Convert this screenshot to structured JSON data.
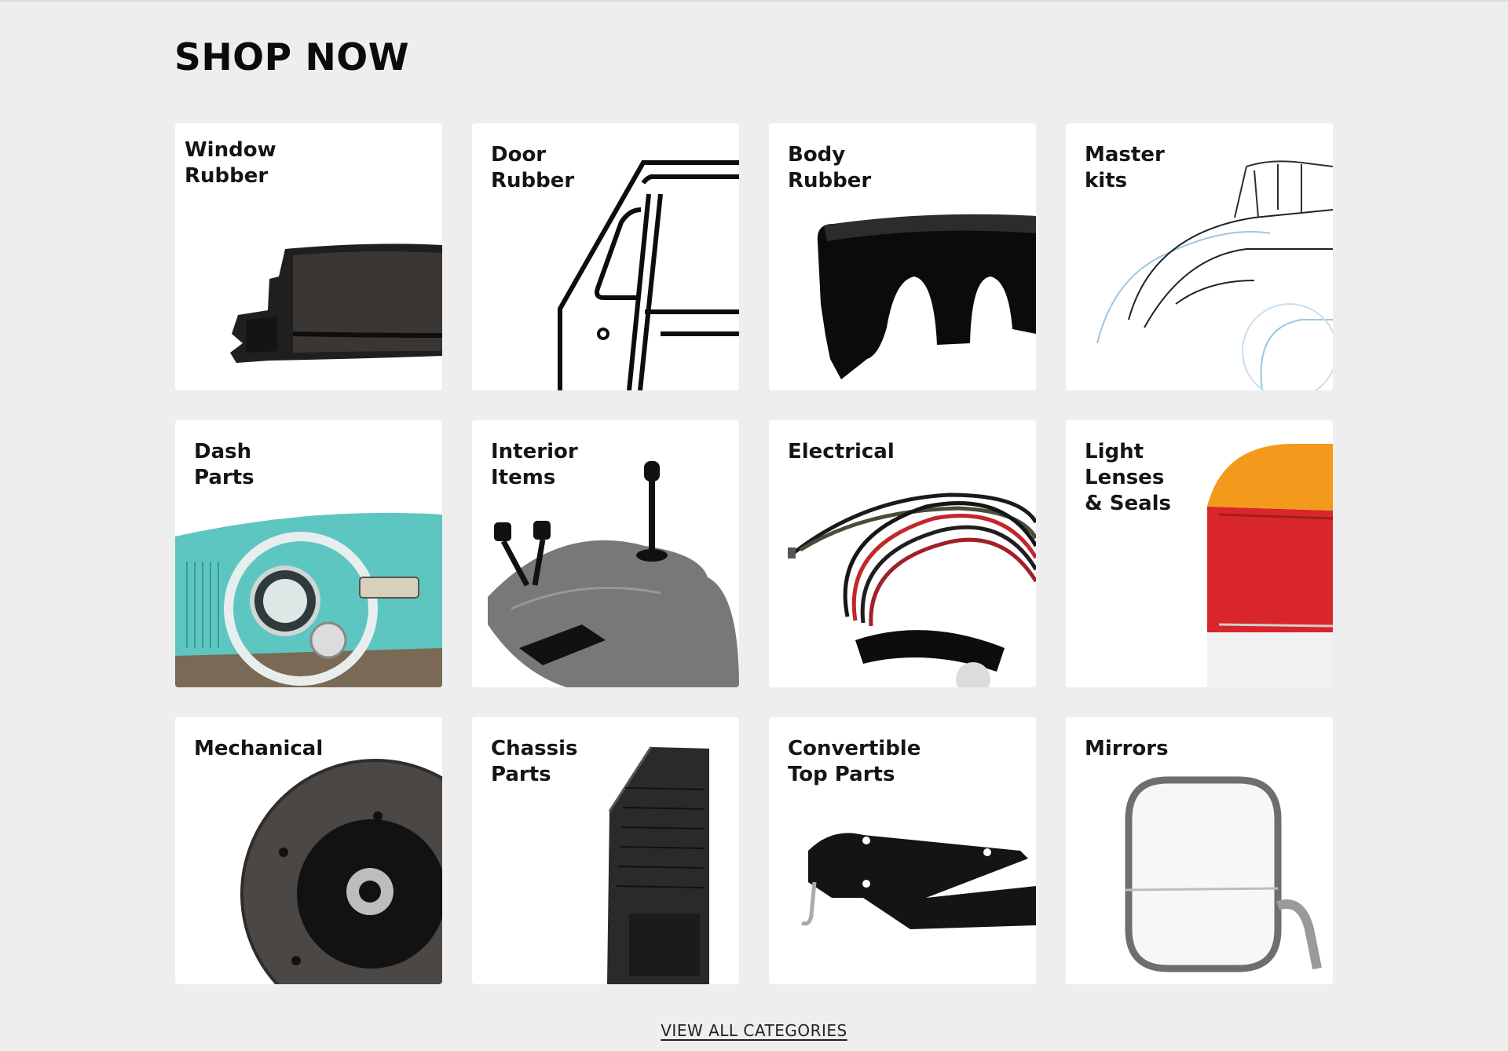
{
  "section": {
    "title": "SHOP NOW",
    "view_all_label": "VIEW ALL CATEGORIES"
  },
  "categories": [
    {
      "label": "Window\nRubber",
      "icon": "window-rubber-image"
    },
    {
      "label": "Door\nRubber",
      "icon": "door-rubber-image"
    },
    {
      "label": "Body\nRubber",
      "icon": "body-rubber-image"
    },
    {
      "label": "Master\nkits",
      "icon": "master-kits-image"
    },
    {
      "label": "Dash\nParts",
      "icon": "dash-parts-image"
    },
    {
      "label": "Interior\nItems",
      "icon": "interior-items-image"
    },
    {
      "label": "Electrical",
      "icon": "electrical-image"
    },
    {
      "label": "Light\nLenses\n& Seals",
      "icon": "light-lenses-image"
    },
    {
      "label": "Mechanical",
      "icon": "mechanical-image"
    },
    {
      "label": "Chassis\nParts",
      "icon": "chassis-parts-image"
    },
    {
      "label": "Convertible\nTop Parts",
      "icon": "convertible-top-image"
    },
    {
      "label": "Mirrors",
      "icon": "mirrors-image"
    }
  ],
  "colors": {
    "page_background": "#eeeeee",
    "card_background": "#ffffff",
    "dash_teal": "#5ec6c0",
    "lens_orange": "#f39a1c",
    "lens_red": "#d9262b"
  }
}
